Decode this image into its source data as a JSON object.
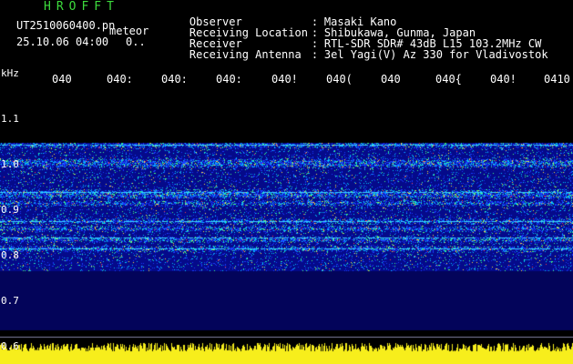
{
  "header": {
    "app_title": "HROFFT",
    "file_name": "UT2510060400.pn",
    "mode_label": "meteor",
    "datetime": "25.10.06 04:00",
    "count": "0..",
    "info_rows": [
      {
        "key": "Observer",
        "sep": ":",
        "value": "Masaki Kano"
      },
      {
        "key": "Receiving Location",
        "sep": ":",
        "value": "Shibukawa, Gunma, Japan"
      },
      {
        "key": "Receiver",
        "sep": ":",
        "value": "RTL-SDR SDR# 43dB L15 103.2MHz CW"
      },
      {
        "key": "Receiving Antenna",
        "sep": ":",
        "value": "3el Yagi(V) Az 330 for Vladivostok"
      }
    ]
  },
  "axis": {
    "y_unit": "kHz",
    "y_labels": [
      "1.1",
      "1.0",
      "0.9",
      "0.8",
      "0.7",
      "0.6"
    ],
    "time_labels": [
      "040",
      "040:",
      "040:",
      "040:",
      "040!",
      "040(",
      "040",
      "040{",
      "040!",
      "0410"
    ]
  },
  "colors": {
    "title_green": "#3ddc3d",
    "background": "#000000",
    "spectro_bg": "#050a8a",
    "signal_yellow": "#f7ee1c"
  }
}
